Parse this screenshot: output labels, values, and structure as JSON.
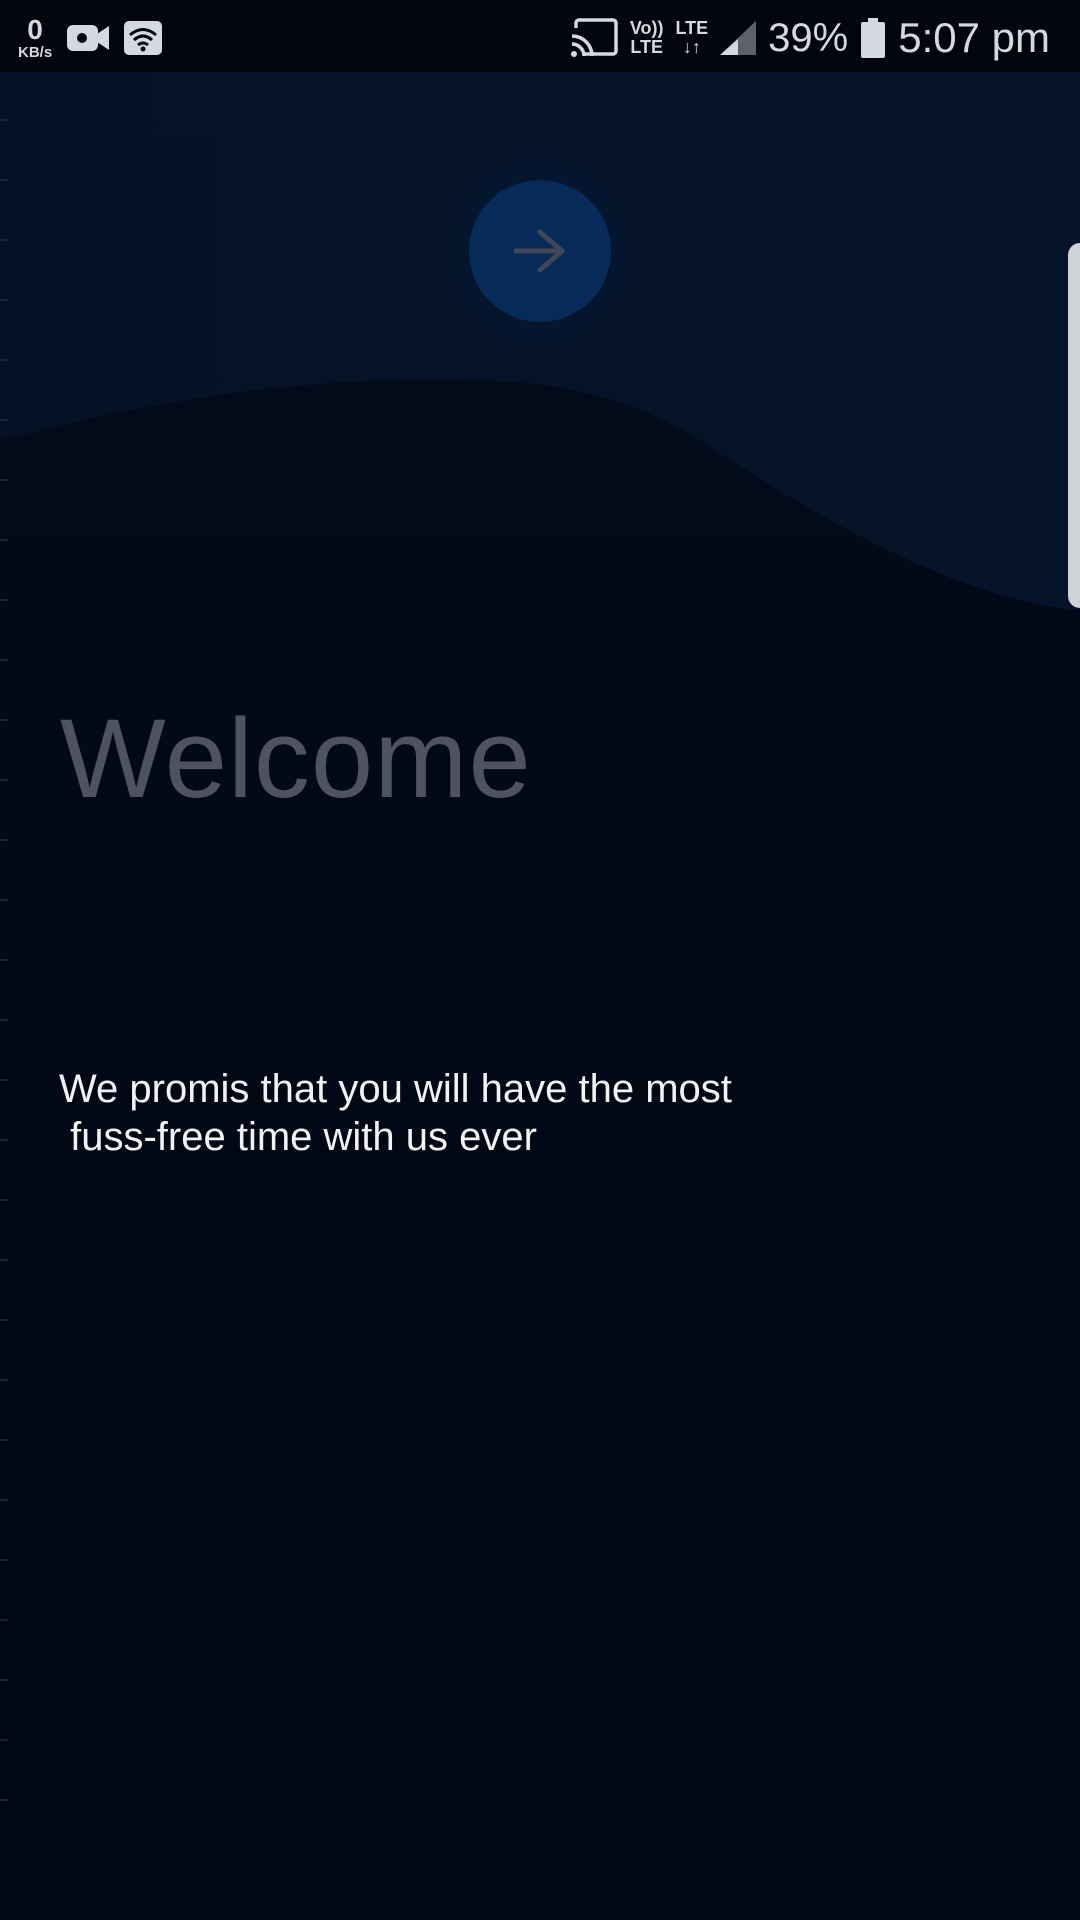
{
  "status_bar": {
    "data_speed_value": "0",
    "data_speed_unit": "KB/s",
    "volte_top": "Vo))",
    "volte_bottom": "LTE",
    "lte_top": "LTE",
    "lte_bottom": "↓↑",
    "battery_percent": "39%",
    "time": "5:07 pm",
    "icons": [
      "video-camera-icon",
      "wifi-icon",
      "cast-icon",
      "signal-icon",
      "battery-icon"
    ]
  },
  "onboarding": {
    "next_button_icon": "arrow-right-icon",
    "title": "Welcome",
    "tagline": "We promis that you will have the most\n fuss-free time with us ever"
  },
  "colors": {
    "background": "#000612",
    "title": "#4f5360",
    "tagline": "#f1f2f4",
    "button": "#072b58",
    "button_halo": "#04162e"
  }
}
